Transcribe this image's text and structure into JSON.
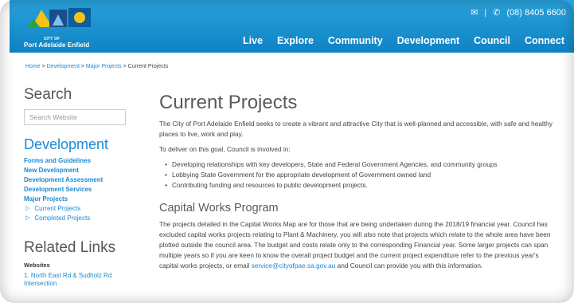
{
  "header": {
    "org_name": "Port Adelaide Enfield",
    "logo_small_text": "CITY OF",
    "mail_icon": "mail-icon",
    "phone_icon": "phone-icon",
    "phone": "(08) 8405 6600",
    "nav": [
      "Live",
      "Explore",
      "Community",
      "Development",
      "Council",
      "Connect"
    ]
  },
  "breadcrumb": {
    "items": [
      "Home",
      "Development",
      "Major Projects",
      "Current Projects"
    ],
    "sep": " > "
  },
  "sidebar": {
    "search_title": "Search",
    "search_placeholder": "Search Website",
    "dev_title": "Development",
    "links": [
      "Forms and Guidelines",
      "New Development",
      "Development Assessment",
      "Development Services",
      "Major Projects"
    ],
    "sub_links": [
      "Current Projects",
      "Completed Projects"
    ],
    "related_title": "Related Links",
    "websites_label": "Websites",
    "websites_link_1": "1. North East Rd & Sudholz Rd",
    "websites_link_2": "Intersection"
  },
  "main": {
    "title": "Current Projects",
    "intro": "The City of Port Adelaide Enfield seeks to create a vibrant and attractive City that is well-planned and accessible, with safe and healthy places to live, work and play.",
    "deliver": "To deliver on this goal, Council is involved in:",
    "bullets": [
      "Developing relationships with key developers, State and Federal Government Agencies, and community groups",
      "Lobbying State Government for the appropriate development of Government owned land",
      "Contributing funding and resources to public development projects."
    ],
    "cap_title": "Capital Works Program",
    "cap_text": "The projects detailed in the Capital Works Map are for those that are being undertaken during the 2018/19 financial year. Council has excluded capital works projects relating to Plant & Machinery, you will also note that projects which relate to the whole area have been plotted outside the council area. The budget and costs relate only to the corresponding Financial year. Some larger projects can span multiple years so if you are keen to know the overall project budget and the current project expenditure refer to the previous year's capital works projects, or email",
    "email": "service@cityofpae.sa.gov.au",
    "cap_tail": " and Council can provide you with this information."
  }
}
